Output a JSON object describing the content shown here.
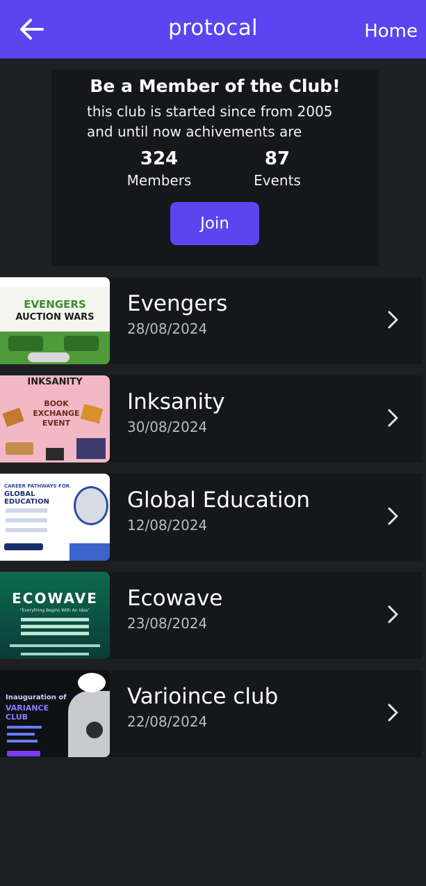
{
  "appbar": {
    "title": "protocal",
    "home_label": "Home",
    "color": "#5b45f0"
  },
  "promo": {
    "title": "Be a Member of the Club!",
    "line1": "this club is started since from 2005",
    "line2": "and until now achivements are",
    "stats": [
      {
        "value": "324",
        "label": "Members"
      },
      {
        "value": "87",
        "label": "Events"
      }
    ],
    "join_label": "Join"
  },
  "events": [
    {
      "name": "Evengers",
      "date": "28/08/2024",
      "thumb": {
        "line1": "EVENGERS",
        "line2": "AUCTION WARS"
      }
    },
    {
      "name": "Inksanity",
      "date": "30/08/2024",
      "thumb": {
        "line1": "INKSANITY",
        "line2": "BOOK EXCHANGE EVENT"
      }
    },
    {
      "name": "Global Education",
      "date": "12/08/2024",
      "thumb": {
        "line1": "CAREER PATHWAYS FOR",
        "line2": "GLOBAL EDUCATION"
      }
    },
    {
      "name": "Ecowave",
      "date": "23/08/2024",
      "thumb": {
        "line1": "ECOWAVE",
        "line2": "\"Everything Begins With An Idea\""
      }
    },
    {
      "name": "Varioince club",
      "date": "22/08/2024",
      "thumb": {
        "line1": "Inauguration of",
        "line2": "VARIANCE CLUB"
      }
    }
  ],
  "icons": {
    "back": "arrow-left-icon",
    "row_chevron": "chevron-right-icon"
  }
}
